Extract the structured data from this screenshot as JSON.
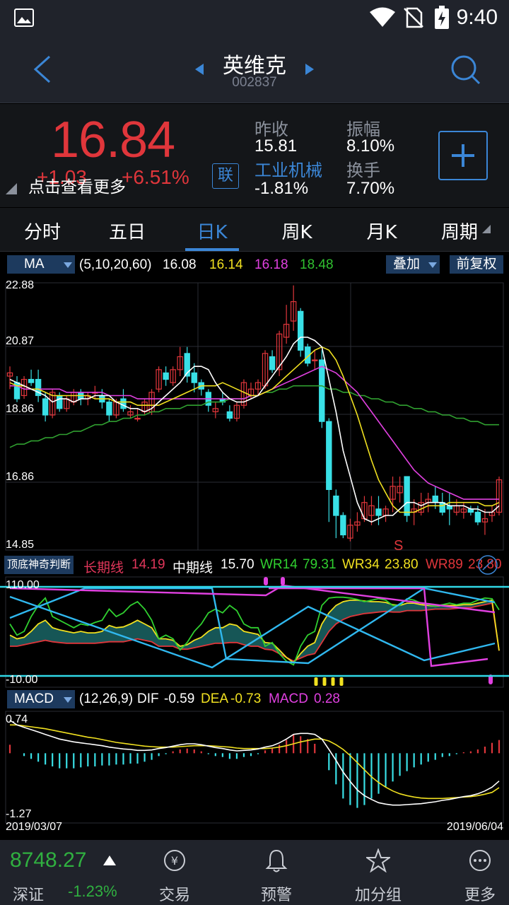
{
  "status_bar": {
    "time": "9:40"
  },
  "header": {
    "title": "英维克",
    "code": "002837"
  },
  "quote": {
    "price": "16.84",
    "change": "+1.03",
    "change_pct": "+6.51%",
    "hint": "点击查看更多",
    "link_badge": "联",
    "fields": {
      "prev_close_label": "昨收",
      "prev_close": "15.81",
      "amplitude_label": "振幅",
      "amplitude": "8.10%",
      "sector_label": "工业机械",
      "sector_change": "-1.81%",
      "turnover_label": "换手",
      "turnover": "7.70%"
    }
  },
  "tabs": [
    "分时",
    "五日",
    "日K",
    "周K",
    "月K",
    "周期"
  ],
  "active_tab": "日K",
  "ma_bar": {
    "selector": "MA",
    "params": "(5,10,20,60)",
    "v5": "16.08",
    "v10": "16.14",
    "v20": "16.18",
    "v60": "18.48",
    "overlay_btn": "叠加",
    "adjust_btn": "前复权"
  },
  "kline_axis": {
    "y_labels": [
      "22.88",
      "20.87",
      "18.86",
      "16.86",
      "14.85"
    ],
    "marker": "S"
  },
  "indicator_bar": {
    "selector": "顶底神奇判断",
    "long_label": "长期线",
    "long_val": "14.19",
    "mid_label": "中期线",
    "mid_val": "15.70",
    "wr14_label": "WR14",
    "wr14_val": "79.31",
    "wr34_label": "WR34",
    "wr34_val": "23.80",
    "wr89_label": "WR89",
    "wr89_val": "23.80",
    "y_top": "110.00",
    "y_bottom": "-10.00"
  },
  "macd_bar": {
    "selector": "MACD",
    "params": "(12,26,9)",
    "dif_label": "DIF",
    "dif": "-0.59",
    "dea_label": "DEA",
    "dea": "-0.73",
    "macd_label": "MACD",
    "macd": "0.28",
    "y_top": "0.74",
    "y_bottom": "-1.27",
    "date_start": "2019/03/07",
    "date_end": "2019/06/04"
  },
  "bottom": {
    "index_value": "8748.27",
    "index_name": "深证",
    "index_change": "-1.23%",
    "nav": [
      "交易",
      "预警",
      "加分组",
      "更多"
    ]
  },
  "colors": {
    "up": "#e0363b",
    "down": "#39e0e6",
    "ma5": "#ffffff",
    "ma10": "#f0e020",
    "ma20": "#e040e0",
    "ma60": "#30a030",
    "accent": "#3b86d6"
  },
  "chart_data": {
    "type": "candlestick",
    "ylim": [
      14.85,
      22.88
    ],
    "candles": [
      [
        20.0,
        20.3,
        19.6,
        20.1
      ],
      [
        19.8,
        20.0,
        19.2,
        19.3
      ],
      [
        19.4,
        20.0,
        19.3,
        19.9
      ],
      [
        19.9,
        20.2,
        19.7,
        19.8
      ],
      [
        19.9,
        20.2,
        19.2,
        19.4
      ],
      [
        19.3,
        19.5,
        18.6,
        18.8
      ],
      [
        18.8,
        19.6,
        18.7,
        19.5
      ],
      [
        19.4,
        19.5,
        18.9,
        19.0
      ],
      [
        19.0,
        19.4,
        18.9,
        19.3
      ],
      [
        19.2,
        19.6,
        19.1,
        19.5
      ],
      [
        19.5,
        19.6,
        19.1,
        19.3
      ],
      [
        19.3,
        19.5,
        19.1,
        19.4
      ],
      [
        19.5,
        19.7,
        19.3,
        19.5
      ],
      [
        19.4,
        19.6,
        19.0,
        19.2
      ],
      [
        19.2,
        19.3,
        18.6,
        18.8
      ],
      [
        18.8,
        19.3,
        18.7,
        19.2
      ],
      [
        19.3,
        19.6,
        18.9,
        19.0
      ],
      [
        18.8,
        19.1,
        18.7,
        18.9
      ],
      [
        18.7,
        19.0,
        18.6,
        18.7
      ],
      [
        18.9,
        19.3,
        18.8,
        19.2
      ],
      [
        18.9,
        19.6,
        18.8,
        19.5
      ],
      [
        19.6,
        20.3,
        19.5,
        20.2
      ],
      [
        20.1,
        20.3,
        19.7,
        19.9
      ],
      [
        19.8,
        20.3,
        19.7,
        20.2
      ],
      [
        20.2,
        20.9,
        20.0,
        20.6
      ],
      [
        20.7,
        20.9,
        19.8,
        20.0
      ],
      [
        20.1,
        20.4,
        19.5,
        19.8
      ],
      [
        19.8,
        19.9,
        19.4,
        19.6
      ],
      [
        19.5,
        19.6,
        18.9,
        19.1
      ],
      [
        18.9,
        19.2,
        18.7,
        19.0
      ],
      [
        19.3,
        19.5,
        19.1,
        19.2
      ],
      [
        18.9,
        19.1,
        18.6,
        18.7
      ],
      [
        18.7,
        19.2,
        18.6,
        19.1
      ],
      [
        19.1,
        19.9,
        19.0,
        19.8
      ],
      [
        19.4,
        19.8,
        19.3,
        19.6
      ],
      [
        19.6,
        19.9,
        19.4,
        19.8
      ],
      [
        19.7,
        20.8,
        19.6,
        20.7
      ],
      [
        20.6,
        20.8,
        20.1,
        20.2
      ],
      [
        20.2,
        21.4,
        20.0,
        21.3
      ],
      [
        21.2,
        22.2,
        21.0,
        21.6
      ],
      [
        21.7,
        22.8,
        21.4,
        22.3
      ],
      [
        22.0,
        22.1,
        20.6,
        20.8
      ],
      [
        20.9,
        21.0,
        20.3,
        20.4
      ],
      [
        20.5,
        20.8,
        20.2,
        20.5
      ],
      [
        20.5,
        20.8,
        18.4,
        18.6
      ],
      [
        18.6,
        18.7,
        15.5,
        16.5
      ],
      [
        16.3,
        16.5,
        15.0,
        15.7
      ],
      [
        15.7,
        15.8,
        15.0,
        15.1
      ],
      [
        15.0,
        15.6,
        14.9,
        15.4
      ],
      [
        15.4,
        15.8,
        15.2,
        15.5
      ],
      [
        15.6,
        16.3,
        15.5,
        16.1
      ],
      [
        15.7,
        16.3,
        15.4,
        16.0
      ],
      [
        15.9,
        16.3,
        15.4,
        15.7
      ],
      [
        15.7,
        16.0,
        15.5,
        15.9
      ],
      [
        16.2,
        16.9,
        15.8,
        16.6
      ],
      [
        16.4,
        16.9,
        16.1,
        16.6
      ],
      [
        16.9,
        16.9,
        15.5,
        15.7
      ],
      [
        15.8,
        16.2,
        15.4,
        15.9
      ],
      [
        15.8,
        16.4,
        15.7,
        16.1
      ],
      [
        16.1,
        16.4,
        15.8,
        16.2
      ],
      [
        16.3,
        16.6,
        15.9,
        16.1
      ],
      [
        16.1,
        16.4,
        15.7,
        15.8
      ],
      [
        16.0,
        16.4,
        15.4,
        15.9
      ],
      [
        15.8,
        16.2,
        15.7,
        16.0
      ],
      [
        15.8,
        16.1,
        15.6,
        15.9
      ],
      [
        15.9,
        16.0,
        15.7,
        15.8
      ],
      [
        15.8,
        16.0,
        15.4,
        15.5
      ],
      [
        15.5,
        15.9,
        15.1,
        15.6
      ],
      [
        15.7,
        16.0,
        15.5,
        15.8
      ],
      [
        15.8,
        16.9,
        15.7,
        16.8
      ]
    ],
    "ma5": [
      19.9,
      19.8,
      19.7,
      19.6,
      19.5,
      19.4,
      19.2,
      19.3,
      19.3,
      19.2,
      19.3,
      19.3,
      19.4,
      19.4,
      19.4,
      19.2,
      19.1,
      19.0,
      19.0,
      18.9,
      19.0,
      19.2,
      19.4,
      19.6,
      19.8,
      20.1,
      20.3,
      20.3,
      20.2,
      19.8,
      19.5,
      19.3,
      19.2,
      19.2,
      19.3,
      19.4,
      19.7,
      20.0,
      20.3,
      20.6,
      21.0,
      21.2,
      21.2,
      21.1,
      20.9,
      19.9,
      18.9,
      17.7,
      16.9,
      16.1,
      15.6,
      15.5,
      15.6,
      15.7,
      15.7,
      15.9,
      16.1,
      16.1,
      16.0,
      16.1,
      16.1,
      16.1,
      16.0,
      16.0,
      16.0,
      15.9,
      15.9,
      15.8,
      15.8,
      16.0
    ],
    "ma10": [
      19.8,
      19.7,
      19.7,
      19.6,
      19.6,
      19.5,
      19.4,
      19.4,
      19.4,
      19.4,
      19.4,
      19.4,
      19.3,
      19.3,
      19.3,
      19.2,
      19.2,
      19.2,
      19.1,
      19.1,
      19.1,
      19.1,
      19.2,
      19.3,
      19.4,
      19.5,
      19.6,
      19.7,
      19.7,
      19.7,
      19.8,
      19.7,
      19.6,
      19.5,
      19.4,
      19.4,
      19.5,
      19.6,
      19.8,
      20.0,
      20.2,
      20.4,
      20.6,
      20.8,
      20.9,
      20.8,
      20.5,
      20.0,
      19.4,
      18.8,
      18.1,
      17.4,
      16.8,
      16.4,
      16.0,
      15.8,
      15.8,
      15.8,
      15.9,
      16.0,
      16.0,
      16.0,
      16.1,
      16.1,
      16.1,
      16.1,
      16.1,
      16.0,
      16.0,
      16.1
    ],
    "ma20": [
      19.7,
      19.7,
      19.6,
      19.6,
      19.6,
      19.6,
      19.6,
      19.6,
      19.5,
      19.5,
      19.5,
      19.5,
      19.5,
      19.5,
      19.4,
      19.4,
      19.4,
      19.4,
      19.3,
      19.3,
      19.3,
      19.3,
      19.3,
      19.3,
      19.3,
      19.3,
      19.3,
      19.3,
      19.3,
      19.3,
      19.3,
      19.3,
      19.3,
      19.3,
      19.4,
      19.4,
      19.5,
      19.6,
      19.7,
      19.8,
      19.9,
      20.0,
      20.1,
      20.2,
      20.3,
      20.2,
      20.1,
      19.9,
      19.7,
      19.5,
      19.2,
      18.9,
      18.6,
      18.3,
      18.0,
      17.7,
      17.4,
      17.1,
      16.9,
      16.7,
      16.6,
      16.5,
      16.4,
      16.3,
      16.2,
      16.2,
      16.2,
      16.2,
      16.2,
      16.2
    ],
    "ma60": [
      17.8,
      17.9,
      17.9,
      18.0,
      18.0,
      18.1,
      18.1,
      18.2,
      18.2,
      18.3,
      18.3,
      18.4,
      18.5,
      18.5,
      18.6,
      18.6,
      18.7,
      18.7,
      18.8,
      18.8,
      18.9,
      18.9,
      19.0,
      19.0,
      19.0,
      19.1,
      19.1,
      19.1,
      19.2,
      19.2,
      19.2,
      19.3,
      19.3,
      19.3,
      19.4,
      19.4,
      19.5,
      19.5,
      19.6,
      19.6,
      19.7,
      19.7,
      19.7,
      19.7,
      19.7,
      19.6,
      19.6,
      19.5,
      19.5,
      19.4,
      19.4,
      19.3,
      19.3,
      19.2,
      19.2,
      19.1,
      19.1,
      19.0,
      19.0,
      18.9,
      18.9,
      18.8,
      18.8,
      18.7,
      18.7,
      18.6,
      18.6,
      18.5,
      18.5,
      18.5
    ],
    "wr14": [
      60,
      45,
      50,
      70,
      85,
      95,
      70,
      65,
      60,
      55,
      60,
      58,
      62,
      65,
      80,
      70,
      75,
      85,
      90,
      80,
      65,
      40,
      45,
      40,
      25,
      35,
      50,
      60,
      75,
      80,
      75,
      85,
      78,
      60,
      55,
      55,
      30,
      35,
      20,
      10,
      5,
      30,
      45,
      50,
      85,
      95,
      96,
      96,
      95,
      93,
      90,
      92,
      94,
      92,
      85,
      85,
      94,
      92,
      88,
      86,
      84,
      86,
      88,
      86,
      88,
      88,
      92,
      95,
      94,
      79
    ],
    "wr34": [
      45,
      40,
      42,
      50,
      60,
      65,
      55,
      52,
      50,
      48,
      50,
      48,
      48,
      50,
      58,
      55,
      56,
      60,
      65,
      60,
      55,
      40,
      40,
      38,
      30,
      32,
      38,
      42,
      50,
      55,
      55,
      60,
      58,
      50,
      48,
      46,
      35,
      34,
      25,
      15,
      8,
      20,
      30,
      35,
      60,
      75,
      85,
      90,
      92,
      92,
      91,
      90,
      90,
      89,
      86,
      85,
      88,
      88,
      86,
      85,
      84,
      85,
      85,
      85,
      86,
      86,
      88,
      90,
      92,
      24
    ],
    "wr89": [
      30,
      30,
      32,
      34,
      36,
      38,
      36,
      35,
      34,
      34,
      34,
      34,
      34,
      35,
      36,
      36,
      36,
      38,
      40,
      38,
      36,
      30,
      30,
      30,
      26,
      26,
      28,
      30,
      32,
      34,
      34,
      35,
      35,
      32,
      30,
      30,
      26,
      25,
      20,
      15,
      10,
      14,
      18,
      20,
      35,
      50,
      60,
      66,
      70,
      72,
      74,
      75,
      76,
      77,
      76,
      76,
      78,
      78,
      78,
      79,
      80,
      80,
      80,
      81,
      82,
      82,
      84,
      86,
      88,
      24
    ],
    "macd_dif": [
      0.7,
      0.6,
      0.55,
      0.5,
      0.45,
      0.4,
      0.35,
      0.3,
      0.27,
      0.24,
      0.22,
      0.2,
      0.18,
      0.16,
      0.13,
      0.11,
      0.09,
      0.08,
      0.06,
      0.06,
      0.07,
      0.1,
      0.12,
      0.15,
      0.18,
      0.2,
      0.2,
      0.18,
      0.15,
      0.12,
      0.1,
      0.07,
      0.05,
      0.06,
      0.07,
      0.09,
      0.13,
      0.16,
      0.22,
      0.3,
      0.4,
      0.42,
      0.42,
      0.4,
      0.3,
      0.08,
      -0.15,
      -0.4,
      -0.6,
      -0.78,
      -0.9,
      -0.98,
      -1.05,
      -1.08,
      -1.1,
      -1.1,
      -1.09,
      -1.08,
      -1.07,
      -1.05,
      -1.03,
      -1.0,
      -0.98,
      -0.95,
      -0.92,
      -0.9,
      -0.86,
      -0.8,
      -0.72,
      -0.59
    ],
    "macd_dea": [
      0.6,
      0.6,
      0.58,
      0.56,
      0.54,
      0.52,
      0.49,
      0.46,
      0.43,
      0.4,
      0.37,
      0.34,
      0.32,
      0.29,
      0.26,
      0.23,
      0.21,
      0.19,
      0.17,
      0.15,
      0.14,
      0.13,
      0.13,
      0.13,
      0.14,
      0.15,
      0.16,
      0.16,
      0.16,
      0.15,
      0.14,
      0.13,
      0.11,
      0.1,
      0.1,
      0.1,
      0.1,
      0.11,
      0.13,
      0.16,
      0.2,
      0.24,
      0.27,
      0.3,
      0.3,
      0.26,
      0.18,
      0.08,
      -0.05,
      -0.2,
      -0.35,
      -0.5,
      -0.62,
      -0.72,
      -0.8,
      -0.86,
      -0.9,
      -0.93,
      -0.95,
      -0.96,
      -0.96,
      -0.96,
      -0.95,
      -0.94,
      -0.93,
      -0.92,
      -0.9,
      -0.87,
      -0.83,
      -0.73
    ],
    "macd_hist": [
      0.18,
      0.0,
      -0.06,
      -0.12,
      -0.18,
      -0.24,
      -0.28,
      -0.32,
      -0.32,
      -0.32,
      -0.3,
      -0.28,
      -0.28,
      -0.26,
      -0.26,
      -0.24,
      -0.24,
      -0.22,
      -0.22,
      -0.18,
      -0.14,
      -0.06,
      -0.02,
      0.04,
      0.08,
      0.1,
      0.08,
      0.04,
      -0.02,
      -0.06,
      -0.08,
      -0.12,
      -0.12,
      -0.08,
      -0.06,
      -0.02,
      0.06,
      0.1,
      0.18,
      0.28,
      0.4,
      0.36,
      0.3,
      0.2,
      0.0,
      -0.36,
      -0.66,
      -0.96,
      -1.1,
      -1.16,
      -1.1,
      -0.96,
      -0.86,
      -0.72,
      -0.6,
      -0.48,
      -0.38,
      -0.3,
      -0.24,
      -0.18,
      -0.14,
      -0.08,
      -0.06,
      -0.02,
      0.02,
      0.04,
      0.08,
      0.14,
      0.22,
      0.28
    ]
  }
}
